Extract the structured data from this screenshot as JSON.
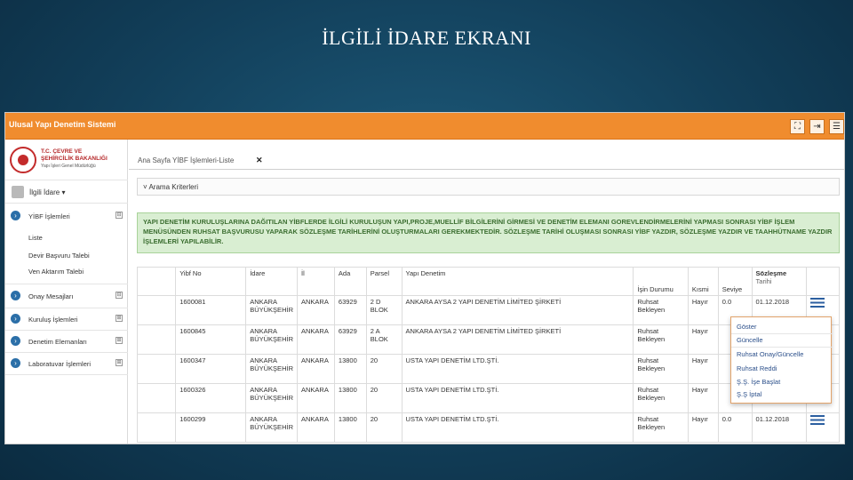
{
  "slide": {
    "title": "İLGİLİ İDARE EKRANI"
  },
  "app": {
    "name": "Ulusal Yapı Denetim Sistemi"
  },
  "toolbar": {
    "buttons": [
      {
        "name": "fullscreen-button",
        "icon": "⛶"
      },
      {
        "name": "logout-button",
        "icon": "⇥"
      },
      {
        "name": "menu-button",
        "icon": "☰"
      }
    ]
  },
  "sidebar": {
    "ministry": {
      "line1": "T.C. ÇEVRE VE",
      "line2": "ŞEHİRCİLİK BAKANLIĞI",
      "line3": "Yapı İşleri Genel Müdürlüğü"
    },
    "user": {
      "label": "İlgili İdare ▾"
    },
    "menu": [
      {
        "label": "YİBF İşlemleri",
        "toggle": "⊟"
      },
      {
        "label": "Onay Mesajları",
        "toggle": "⊟"
      },
      {
        "label": "Kuruluş İşlemleri",
        "toggle": "⊞"
      },
      {
        "label": "Denetim Elemanları",
        "toggle": "⊞"
      },
      {
        "label": "Laboratuvar İşlemleri",
        "toggle": "⊞"
      }
    ],
    "submenu": [
      "Liste",
      "Devir Başvuru Talebi",
      "Ven Aktarım Talebi"
    ]
  },
  "main": {
    "breadcrumb": "Ana Sayfa   YİBF İşlemleri-Liste",
    "tab_close": "✕",
    "criteria_label": "˅ Arama Kriterleri",
    "notice": "YAPI DENETİM KURULUŞLARINA DAĞITILAN YİBFLERDE İLGİLİ KURULUŞUN YAPI,PROJE,MUELLİF BİLGİLERİNİ GİRMESİ VE DENETİM ELEMANI GOREVLENDİRMELERİNİ YAPMASI SONRASI YİBF İŞLEM MENÜSÜNDEN RUHSAT BAŞVURUSU YAPARAK SÖZLEŞME TARİHLERİNİ OLUŞTURMALARI GEREKMEKTEDİR. SÖZLEŞME TARİHİ OLUŞMASI SONRASI YİBF YAZDIR, SÖZLEŞME YAZDIR VE TAAHHÜTNAME YAZDIR İŞLEMLERİ YAPILABİLİR."
  },
  "table": {
    "headers": {
      "yibf_no": "Yibf No",
      "idare": "İdare",
      "il": "İl",
      "ada": "Ada",
      "parsel": "Parsel",
      "yapi_denetim": "Yapı Denetim",
      "isin_durumu": "İşin Durumu",
      "kismi": "Kısmi",
      "seviye": "Seviye",
      "sozlesme": "Sözleşme",
      "sozlesme_sub": "Tarihi"
    },
    "rows": [
      {
        "yibf_no": "1600081",
        "idare": "ANKARA BÜYÜKŞEHİR",
        "il": "ANKARA",
        "ada": "63929",
        "parsel": "2 D BLOK",
        "yapi_denetim": "ANKARA AYSA 2 YAPI DENETİM LİMİTED ŞİRKETİ",
        "isin_durumu": "Ruhsat Bekleyen",
        "kismi": "Hayır",
        "seviye": "0.0",
        "sozlesme": "01.12.2018"
      },
      {
        "yibf_no": "1600845",
        "idare": "ANKARA BÜYÜKŞEHİR",
        "il": "ANKARA",
        "ada": "63929",
        "parsel": "2 A BLOK",
        "yapi_denetim": "ANKARA AYSA 2 YAPI DENETİM LİMİTED ŞİRKETİ",
        "isin_durumu": "Ruhsat Bekleyen",
        "kismi": "Hayır",
        "seviye": "",
        "sozlesme": ""
      },
      {
        "yibf_no": "1600347",
        "idare": "ANKARA BÜYÜKŞEHİR",
        "il": "ANKARA",
        "ada": "13800",
        "parsel": "20",
        "yapi_denetim": "USTA YAPI DENETİM LTD.ŞTİ.",
        "isin_durumu": "Ruhsat Bekleyen",
        "kismi": "Hayır",
        "seviye": "",
        "sozlesme": ""
      },
      {
        "yibf_no": "1600326",
        "idare": "ANKARA BÜYÜKŞEHİR",
        "il": "ANKARA",
        "ada": "13800",
        "parsel": "20",
        "yapi_denetim": "USTA YAPI DENETİM LTD.ŞTİ.",
        "isin_durumu": "Ruhsat Bekleyen",
        "kismi": "Hayır",
        "seviye": "",
        "sozlesme": ""
      },
      {
        "yibf_no": "1600299",
        "idare": "ANKARA BÜYÜKŞEHİR",
        "il": "ANKARA",
        "ada": "13800",
        "parsel": "20",
        "yapi_denetim": "USTA YAPI DENETİM LTD.ŞTİ.",
        "isin_durumu": "Ruhsat Bekleyen",
        "kismi": "Hayır",
        "seviye": "0.0",
        "sozlesme": "01.12.2018"
      }
    ]
  },
  "dropdown": {
    "items": [
      "Göster",
      "Güncelle",
      "Ruhsat Onay/Güncelle",
      "Ruhsat Reddi",
      "Ş.Ş. İşe Başlat",
      "Ş.Ş İptal"
    ]
  }
}
